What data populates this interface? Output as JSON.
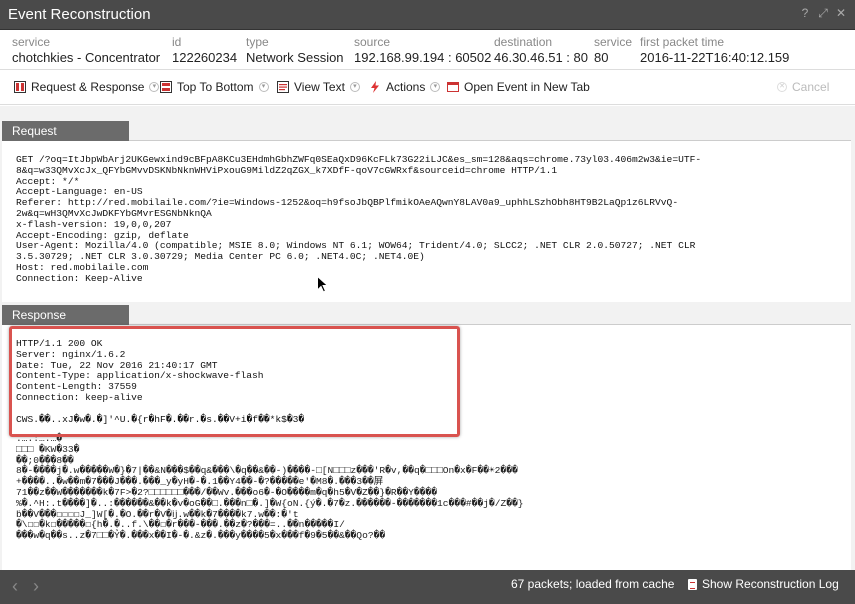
{
  "window": {
    "title": "Event Reconstruction"
  },
  "meta": [
    {
      "label": "service",
      "value": "chotchkies - Concentrator"
    },
    {
      "label": "id",
      "value": "122260234"
    },
    {
      "label": "type",
      "value": "Network Session"
    },
    {
      "label": "source",
      "value": "192.168.99.194 : 60502"
    },
    {
      "label": "destination",
      "value": "46.30.46.51 : 80"
    },
    {
      "label": "service",
      "value": "80"
    },
    {
      "label": "first packet time",
      "value": "2016-11-22T16:40:12.159"
    }
  ],
  "toolbar": {
    "request_response": "Request & Response",
    "top_to_bottom": "Top To Bottom",
    "view_text": "View Text",
    "actions": "Actions",
    "open_new_tab": "Open Event in New Tab",
    "cancel": "Cancel"
  },
  "sections": {
    "request": "Request",
    "response": "Response"
  },
  "request_text": "GET /?oq=ItJbpWbArj2UKGewxind9cBFpA8KCu3EHdmhGbhZWFq0SEaQxD96KcFLk73G22iLJC&es_sm=128&aqs=chrome.73yl03.406m2w3&ie=UTF-\n8&q=w33QMvXcJx_QFYbGMvvDSKNbNknWHViPxouG9MildZ2qZGX_k7XDfF-qoV7cGWRxf&sourceid=chrome HTTP/1.1\nAccept: */*\nAccept-Language: en-US\nReferer: http://red.mobilaile.com/?ie=Windows-1252&oq=h9fsoJbQBPlfmikOAeAQwnY8LAV0a9_uphhLSzhObh8HT9B2LaQp1z6LRVvQ-\n2w&q=wH3QMvXcJwDKFYbGMvrESGNbNknQA\nx-flash-version: 19,0,0,207\nAccept-Encoding: gzip, deflate\nUser-Agent: Mozilla/4.0 (compatible; MSIE 8.0; Windows NT 6.1; WOW64; Trident/4.0; SLCC2; .NET CLR 2.0.50727; .NET CLR\n3.5.30729; .NET CLR 3.0.30729; Media Center PC 6.0; .NET4.0C; .NET4.0E)\nHost: red.mobilaile.com\nConnection: Keep-Alive",
  "response_text": "HTTP/1.1 200 OK\nServer: nginx/1.6.2\nDate: Tue, 22 Nov 2016 21:40:17 GMT\nContent-Type: application/x-shockwave-flash\nContent-Length: 37559\nConnection: keep-alive\n\nCWS.��..xJ�w�.�]'^U.�{r�hF�.��r.�s.��V+i�f��*k$�3�",
  "binary_text": ".….:….…�\n□□□ �KW�33�\n��;0���8��\n8�-����j�.w�����W�}�7|��&N���$��q&���\\�q��&��-)����-□[N□□□z���'R�v,��q�□□□On�x�F��☀2���\n+����..�w��m�7���J���.���_y�yH�-�.1��Y4��-�?�����e'�M8�.���3��屏\n71��z��W�������k�7F>�2?□□□□□□���/��Wv.���o6�-�O����m�q�h5�V�Z��}�R��Y����\n%�.^H:.t����]�..:������&��k�v�oG��□.���n□�.]�W{oN.{ý�.�7�z.������-�������1c���#��j�/Z��}\nḃ��V���☐☐☐☐J_]W[�.�O.��r�V�ĳ.w��k�7����k7.w��:�'t\n�\\☐☐�k☐�����☐{h�.�..f.\\��☐�r���-���.��z�?���=..��n�����I/\n���w�q��s..z�7□□�Ỷ�.���x��I�-�.&z�.���y����5�x���f�9�5��&��Qo?��",
  "status": {
    "packets": "67 packets; loaded from cache",
    "show_log": "Show Reconstruction Log"
  },
  "colors": {
    "titlebar": "#4a4a4a",
    "section_header": "#6b6b6b",
    "highlight_border": "#d9534f"
  }
}
